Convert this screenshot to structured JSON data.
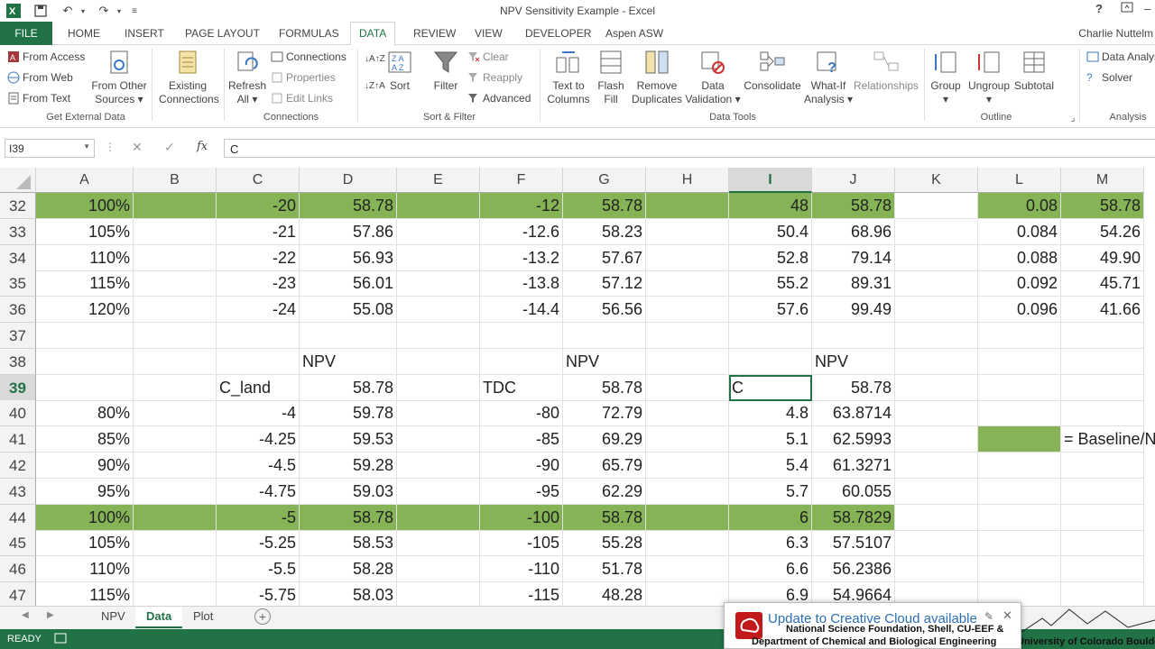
{
  "title_bar": {
    "title": "NPV Sensitivity Example - Excel",
    "help": "?"
  },
  "ribbon_tabs": [
    "FILE",
    "HOME",
    "INSERT",
    "PAGE LAYOUT",
    "FORMULAS",
    "DATA",
    "REVIEW",
    "VIEW",
    "DEVELOPER",
    "Aspen ASW"
  ],
  "user_name": "Charlie Nuttelm",
  "ribbon": {
    "get_external": {
      "from_access": "From Access",
      "from_web": "From Web",
      "from_text": "From Text",
      "from_other_1": "From Other",
      "from_other_2": "Sources",
      "group": "Get External Data"
    },
    "existing": {
      "line1": "Existing",
      "line2": "Connections"
    },
    "connections": {
      "refresh_1": "Refresh",
      "refresh_2": "All",
      "connections": "Connections",
      "properties": "Properties",
      "edit_links": "Edit Links",
      "group": "Connections"
    },
    "sort_filter": {
      "sort": "Sort",
      "filter": "Filter",
      "clear": "Clear",
      "reapply": "Reapply",
      "advanced": "Advanced",
      "group": "Sort & Filter"
    },
    "data_tools": {
      "ttc_1": "Text to",
      "ttc_2": "Columns",
      "flash_1": "Flash",
      "flash_2": "Fill",
      "remove_1": "Remove",
      "remove_2": "Duplicates",
      "valid_1": "Data",
      "valid_2": "Validation",
      "consolidate": "Consolidate",
      "whatif_1": "What-If",
      "whatif_2": "Analysis",
      "relationships": "Relationships",
      "group": "Data Tools"
    },
    "outline": {
      "group_btn": "Group",
      "ungroup": "Ungroup",
      "subtotal": "Subtotal",
      "group": "Outline"
    },
    "analysis": {
      "data_analysis": "Data Analys",
      "solver": "Solver",
      "group": "Analysis"
    }
  },
  "formula_bar": {
    "name_box": "I39",
    "fx": "fx",
    "value": "C"
  },
  "columns": [
    "A",
    "B",
    "C",
    "D",
    "E",
    "F",
    "G",
    "H",
    "I",
    "J",
    "K",
    "L",
    "M"
  ],
  "rows": [
    {
      "n": "32",
      "A": "100%",
      "C": "-20",
      "D": "58.78",
      "F": "-12",
      "G": "58.78",
      "I": "48",
      "J": "58.78",
      "L": "0.08",
      "M": "58.78",
      "green": true
    },
    {
      "n": "33",
      "A": "105%",
      "C": "-21",
      "D": "57.86",
      "F": "-12.6",
      "G": "58.23",
      "I": "50.4",
      "J": "68.96",
      "L": "0.084",
      "M": "54.26"
    },
    {
      "n": "34",
      "A": "110%",
      "C": "-22",
      "D": "56.93",
      "F": "-13.2",
      "G": "57.67",
      "I": "52.8",
      "J": "79.14",
      "L": "0.088",
      "M": "49.90"
    },
    {
      "n": "35",
      "A": "115%",
      "C": "-23",
      "D": "56.01",
      "F": "-13.8",
      "G": "57.12",
      "I": "55.2",
      "J": "89.31",
      "L": "0.092",
      "M": "45.71"
    },
    {
      "n": "36",
      "A": "120%",
      "C": "-24",
      "D": "55.08",
      "F": "-14.4",
      "G": "56.56",
      "I": "57.6",
      "J": "99.49",
      "L": "0.096",
      "M": "41.66"
    },
    {
      "n": "37"
    },
    {
      "n": "38",
      "D_left": "NPV",
      "G_left": "NPV",
      "J_left": "NPV"
    },
    {
      "n": "39",
      "C_left": "C_land",
      "D": "58.78",
      "F_left": "TDC",
      "G": "58.78",
      "I_left": "C",
      "J": "58.78"
    },
    {
      "n": "40",
      "A": "80%",
      "C": "-4",
      "D": "59.78",
      "F": "-80",
      "G": "72.79",
      "I": "4.8",
      "J": "63.8714"
    },
    {
      "n": "41",
      "A": "85%",
      "C": "-4.25",
      "D": "59.53",
      "F": "-85",
      "G": "69.29",
      "I": "5.1",
      "J": "62.5993",
      "M_left": "= Baseline/N"
    },
    {
      "n": "42",
      "A": "90%",
      "C": "-4.5",
      "D": "59.28",
      "F": "-90",
      "G": "65.79",
      "I": "5.4",
      "J": "61.3271"
    },
    {
      "n": "43",
      "A": "95%",
      "C": "-4.75",
      "D": "59.03",
      "F": "-95",
      "G": "62.29",
      "I": "5.7",
      "J": "60.055"
    },
    {
      "n": "44",
      "A": "100%",
      "C": "-5",
      "D": "58.78",
      "F": "-100",
      "G": "58.78",
      "I": "6",
      "J": "58.7829",
      "green": true
    },
    {
      "n": "45",
      "A": "105%",
      "C": "-5.25",
      "D": "58.53",
      "F": "-105",
      "G": "55.28",
      "I": "6.3",
      "J": "57.5107"
    },
    {
      "n": "46",
      "A": "110%",
      "C": "-5.5",
      "D": "58.28",
      "F": "-110",
      "G": "51.78",
      "I": "6.6",
      "J": "56.2386"
    },
    {
      "n": "47",
      "A": "115%",
      "C": "-5.75",
      "D": "58.03",
      "F": "-115",
      "G": "48.28",
      "I": "6.9",
      "J": "54.9664"
    }
  ],
  "sheet_tabs": [
    "NPV",
    "Data",
    "Plot"
  ],
  "active_sheet": "Data",
  "status": "READY",
  "notification": {
    "text": "Update to Creative Cloud available",
    "sub1": "National Science Foundation, Shell, CU-EEF &",
    "sub2": "Department of Chemical and Biological Engineering"
  },
  "watermark": "University of Colorado Boulder",
  "colors": {
    "excel_green": "#217346",
    "highlight_green": "#86b356"
  }
}
